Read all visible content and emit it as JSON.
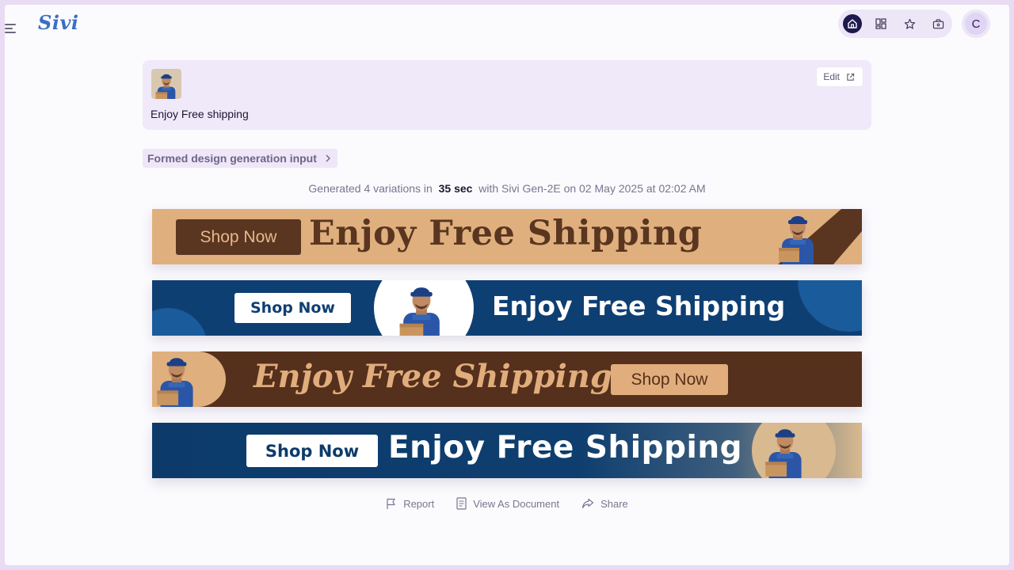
{
  "app": {
    "logo": "Sivi"
  },
  "header": {
    "nav": [
      "home-icon",
      "grid-icon",
      "star-icon",
      "briefcase-icon"
    ],
    "avatar_initial": "C"
  },
  "input_card": {
    "prompt": "Enjoy Free shipping",
    "edit_label": "Edit"
  },
  "formed_input_label": "Formed design generation input",
  "generation": {
    "prefix": "Generated 4 variations in",
    "duration": "35 sec",
    "suffix": "with Sivi Gen-2E on 02 May 2025 at 02:02 AM"
  },
  "banners": [
    {
      "cta": "Shop Now",
      "headline": "Enjoy Free Shipping"
    },
    {
      "cta": "Shop Now",
      "headline": "Enjoy Free Shipping"
    },
    {
      "cta": "Shop Now",
      "headline": "Enjoy Free Shipping"
    },
    {
      "cta": "Shop Now",
      "headline": "Enjoy Free Shipping"
    }
  ],
  "actions": {
    "report": "Report",
    "view_document": "View As Document",
    "share": "Share"
  },
  "colors": {
    "brand": "#3a6fc4",
    "tan": "#dfb07e",
    "brown": "#55301c",
    "navy": "#0e3f73"
  }
}
